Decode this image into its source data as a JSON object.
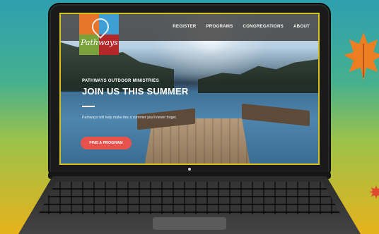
{
  "site": {
    "logo_text": "Pathways",
    "nav": [
      "REGISTER",
      "PROGRAMS",
      "CONGREGATIONS",
      "ABOUT"
    ],
    "hero": {
      "eyebrow": "PATHWAYS OUTDOOR MINISTRIES",
      "headline": "JOIN US THIS SUMMER",
      "tagline": "Pathways will help make this a summer you'll never forget.",
      "cta_label": "FIND A PROGRAM"
    }
  },
  "colors": {
    "accent": "#e8524c",
    "nav_bg": "#464646",
    "logo_orange": "#e8752a",
    "logo_blue": "#3f9fd4",
    "logo_green": "#7ba23a",
    "logo_red": "#b3262a"
  },
  "icons": {
    "leaf": "maple-leaf-icon"
  }
}
